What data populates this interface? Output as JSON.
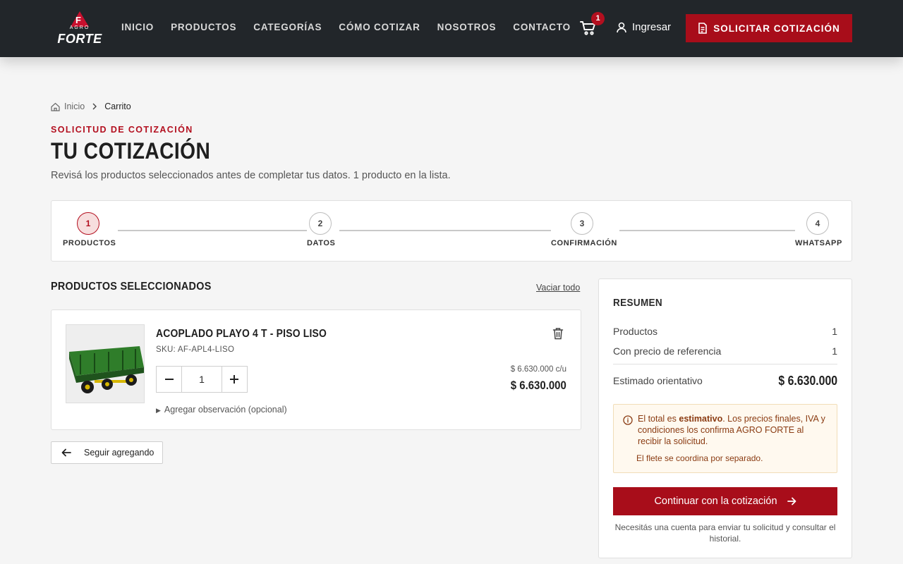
{
  "brand": {
    "logo_agro": "AGRO",
    "logo_forte": "FORTE",
    "logo_mark": "F",
    "accent_color": "#b30f1f",
    "header_bg": "#22262a"
  },
  "nav": {
    "items": [
      "INICIO",
      "PRODUCTOS",
      "CATEGORÍAS",
      "CÓMO COTIZAR",
      "NOSOTROS",
      "CONTACTO"
    ],
    "cart_count": "1",
    "login_label": "Ingresar",
    "cta_label": "SOLICITAR COTIZACIÓN"
  },
  "breadcrumb": {
    "home": "Inicio",
    "current": "Carrito"
  },
  "page": {
    "eyebrow": "SOLICITUD DE COTIZACIÓN",
    "title": "TU COTIZACIÓN",
    "subtitle": "Revisá los productos seleccionados antes de completar tus datos. 1 producto en la lista."
  },
  "stepper": {
    "steps": [
      {
        "number": "1",
        "label": "PRODUCTOS",
        "active": true
      },
      {
        "number": "2",
        "label": "DATOS",
        "active": false
      },
      {
        "number": "3",
        "label": "CONFIRMACIÓN",
        "active": false
      },
      {
        "number": "4",
        "label": "WHATSAPP",
        "active": false
      }
    ]
  },
  "products": {
    "section_title": "PRODUCTOS SELECCIONADOS",
    "clear_all": "Vaciar todo",
    "items": [
      {
        "name": "ACOPLADO PLAYO 4 T - PISO LISO",
        "sku": "SKU: AF-APL4-LISO",
        "quantity": "1",
        "unit_price": "$ 6.630.000 c/u",
        "total_price": "$ 6.630.000",
        "observation_toggle": "Agregar observación (opcional)"
      }
    ],
    "back_button": "Seguir agregando"
  },
  "summary": {
    "title": "RESUMEN",
    "rows": [
      {
        "label": "Productos",
        "value": "1"
      },
      {
        "label": "Con precio de referencia",
        "value": "1"
      }
    ],
    "estimate_label": "Estimado orientativo",
    "estimate_value": "$ 6.630.000",
    "notice_prefix": "El total es ",
    "notice_bold": "estimativo",
    "notice_suffix": ". Los precios finales, IVA y condiciones los confirma AGRO FORTE al recibir la solicitud.",
    "notice_freight": "El flete se coordina por separado.",
    "continue_label": "Continuar con la cotización",
    "account_note": "Necesitás una cuenta para enviar tu solicitud y consultar el historial."
  }
}
